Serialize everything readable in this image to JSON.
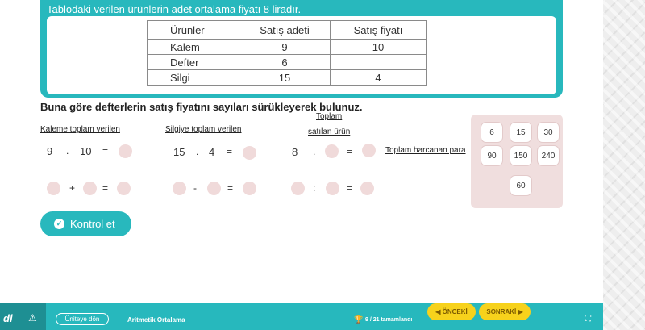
{
  "question": {
    "title": "Tablodaki verilen ürünlerin adet ortalama fiyatı 8 liradır.",
    "table": {
      "headers": [
        "Ürünler",
        "Satış adeti",
        "Satış fiyatı"
      ],
      "rows": [
        [
          "Kalem",
          "9",
          "10"
        ],
        [
          "Defter",
          "6",
          ""
        ],
        [
          "Silgi",
          "15",
          "4"
        ]
      ]
    }
  },
  "instruction": "Buna göre defterlerin satış fiyatını sayıları sürükleyerek bulunuz.",
  "groups": {
    "kalem": {
      "label": "Kaleme toplam verilen",
      "row1": {
        "a": "9",
        "op": ".",
        "b": "10",
        "eq": "="
      },
      "row2": {
        "op": "+",
        "eq": "="
      }
    },
    "silgi": {
      "label": "Silgiye toplam verilen",
      "row1": {
        "a": "15",
        "op": ".",
        "b": "4",
        "eq": "="
      },
      "row2": {
        "op": "-",
        "eq": "="
      }
    },
    "toplam": {
      "label_line1": "Toplam",
      "label_line2": "satılan ürün",
      "row1": {
        "a": "8",
        "op": ".",
        "eq": "="
      },
      "row2": {
        "op": ":",
        "eq": "="
      },
      "side_label": "Toplam harcanan para"
    }
  },
  "tiles": [
    "6",
    "15",
    "30",
    "90",
    "150",
    "240",
    "60"
  ],
  "check_button": {
    "label": "Kontrol et",
    "icon": "check-circle-icon"
  },
  "bottom_bar": {
    "logo": "dl",
    "warning_icon": "⚠",
    "back_label": "Üniteye dön",
    "lesson_title": "Aritmetik Ortalama",
    "progress_icon": "trophy-icon",
    "progress_text": "9 / 21 tamamlandı",
    "prev_label": "◀ ÖNCEKİ",
    "next_label": "SONRAKİ ▶",
    "fullscreen_icon": "⛶"
  },
  "colors": {
    "teal": "#28b8bd",
    "slot_pink": "#f0dada",
    "nav_yellow": "#f7d21c"
  }
}
